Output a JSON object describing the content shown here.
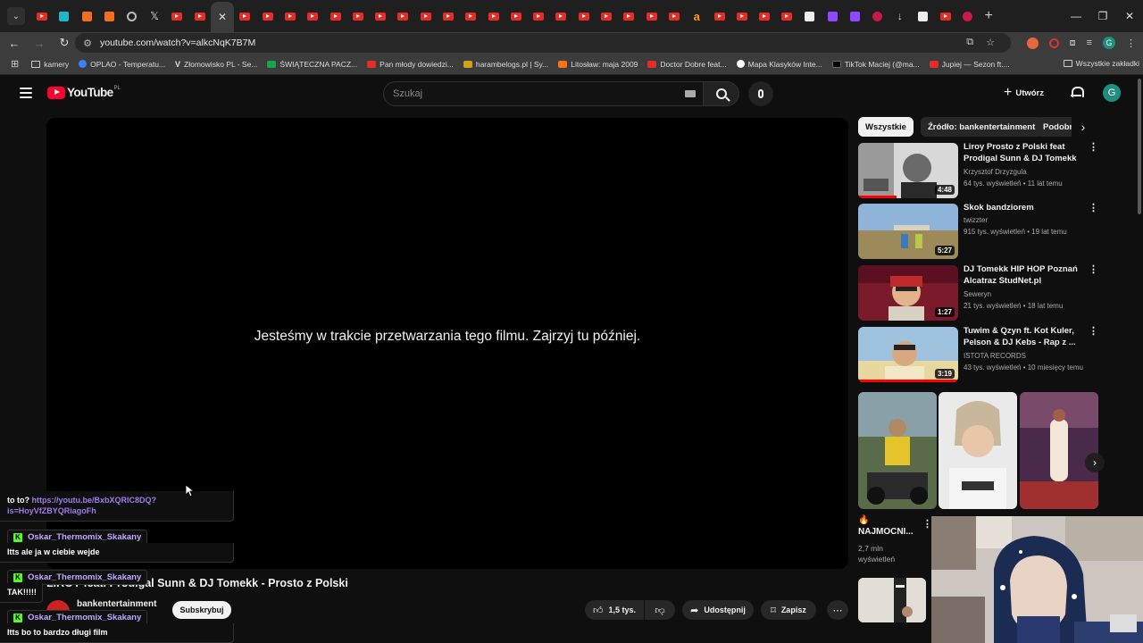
{
  "browser": {
    "url": "youtube.com/watch?v=alkcNqK7B7M",
    "bookmarks": [
      {
        "label": "kamery",
        "icon": "folder"
      },
      {
        "label": "OPLAO - Temperatu...",
        "icon": "blue"
      },
      {
        "label": "Złomowisko PL - Se...",
        "icon": "vv"
      },
      {
        "label": "ŚWIĄTECZNA PACZ...",
        "icon": "green"
      },
      {
        "label": "Pan młody dowiedzi...",
        "icon": "yt"
      },
      {
        "label": "harambelogs.pl | Sy...",
        "icon": "gold"
      },
      {
        "label": "Litosław: maja 2009",
        "icon": "orange"
      },
      {
        "label": "Doctor Dobre feat...",
        "icon": "yt"
      },
      {
        "label": "Mapa Klasyków Inte...",
        "icon": "white"
      },
      {
        "label": "TikTok Maciej (@ma...",
        "icon": "tt"
      },
      {
        "label": "Jupiej — Sezon ft....",
        "icon": "yt"
      }
    ],
    "all_bookmarks": "Wszystkie zakładki"
  },
  "youtube": {
    "logo_text": "YouTube",
    "logo_country": "PL",
    "search_placeholder": "Szukaj",
    "create_label": "Utwórz",
    "avatar_letter": "G",
    "player_message": "Jesteśmy w trakcie przetwarzania tego filmu. Zajrzyj tu później.",
    "video_title": "LIROY feat. Prodigal Sunn & DJ Tomekk - Prosto z Polski",
    "channel_name": "bankentertainment",
    "subscribe_label": "Subskrybuj",
    "like_count": "1,5 tys.",
    "share_label": "Udostępnij",
    "save_label": "Zapisz",
    "chips": [
      "Wszystkie",
      "Źródło: bankentertainment",
      "Podobne"
    ],
    "recommendations": [
      {
        "title": "Liroy   Prosto z Polski feat Prodigal Sunn & DJ Tomekk",
        "channel": "Krzysztof Drzyzgula",
        "meta": "64 tys. wyświetleń • 11 lat temu",
        "duration": "4:48",
        "progress": 0.38,
        "thumb": "bw"
      },
      {
        "title": "Skok bandziorem",
        "channel": "twizzter",
        "meta": "915 tys. wyświetleń • 19 lat temu",
        "duration": "5:27",
        "progress": 0,
        "thumb": "field"
      },
      {
        "title": "DJ Tomekk HIP HOP Poznań Alcatraz StudNet.pl",
        "channel": "Seweryn",
        "meta": "21 tys. wyświetleń • 18 lat temu",
        "duration": "1:27",
        "progress": 0,
        "thumb": "red"
      },
      {
        "title": "Tuwim & Qzyn ft. Kot Kuler, Pelson & DJ Kebs - Rap z ...",
        "channel": "ISTOTA RECORDS",
        "meta": "43 tys. wyświetleń • 10 miesięcy temu",
        "duration": "3:19",
        "progress": 1.0,
        "thumb": "selfie"
      }
    ],
    "short": {
      "fire": "🔥",
      "title": "NAJMOCNI...",
      "views_line1": "2,7 mln",
      "views_line2": "wyświetleń"
    }
  },
  "chat": {
    "messages": [
      {
        "prefix": "to to? ",
        "link": "https://youtu.be/BxbXQRIC8DQ?is=HoyVfZBYQRiagoFh"
      },
      {
        "user": "Oskar_Thermomix_Skakany",
        "text": "Itts ale ja w ciebie wejde"
      },
      {
        "user": "Oskar_Thermomix_Skakany",
        "text": "TAK!!!!!"
      },
      {
        "user": "Oskar_Thermomix_Skakany",
        "text": "Itts bo to bardzo długi film"
      }
    ]
  }
}
